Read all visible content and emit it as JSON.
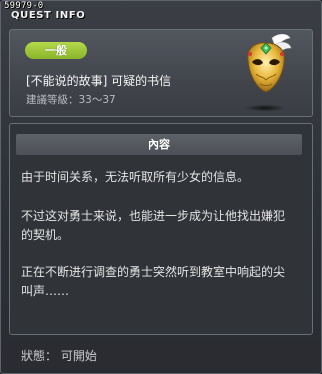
{
  "window": {
    "id_label": "59979-0",
    "title": "QUEST INFO"
  },
  "quest": {
    "category": "一般",
    "name": "[不能说的故事] 可疑的书信",
    "level": "建議等級：33～37",
    "icon": "golden-masquerade-mask-icon"
  },
  "content": {
    "header": "內容",
    "paragraphs": [
      "由于时间关系，无法听取所有少女的信息。",
      "不过这对勇士来说，也能进一步成为让他找出嫌犯的契机。",
      "正在不断进行调查的勇士突然听到教室中响起的尖叫声……"
    ]
  },
  "status": "狀態： 可開始",
  "colors": {
    "badge": "#9cc638",
    "panel_border": "#6a6e76",
    "background": "#2c2f35"
  }
}
